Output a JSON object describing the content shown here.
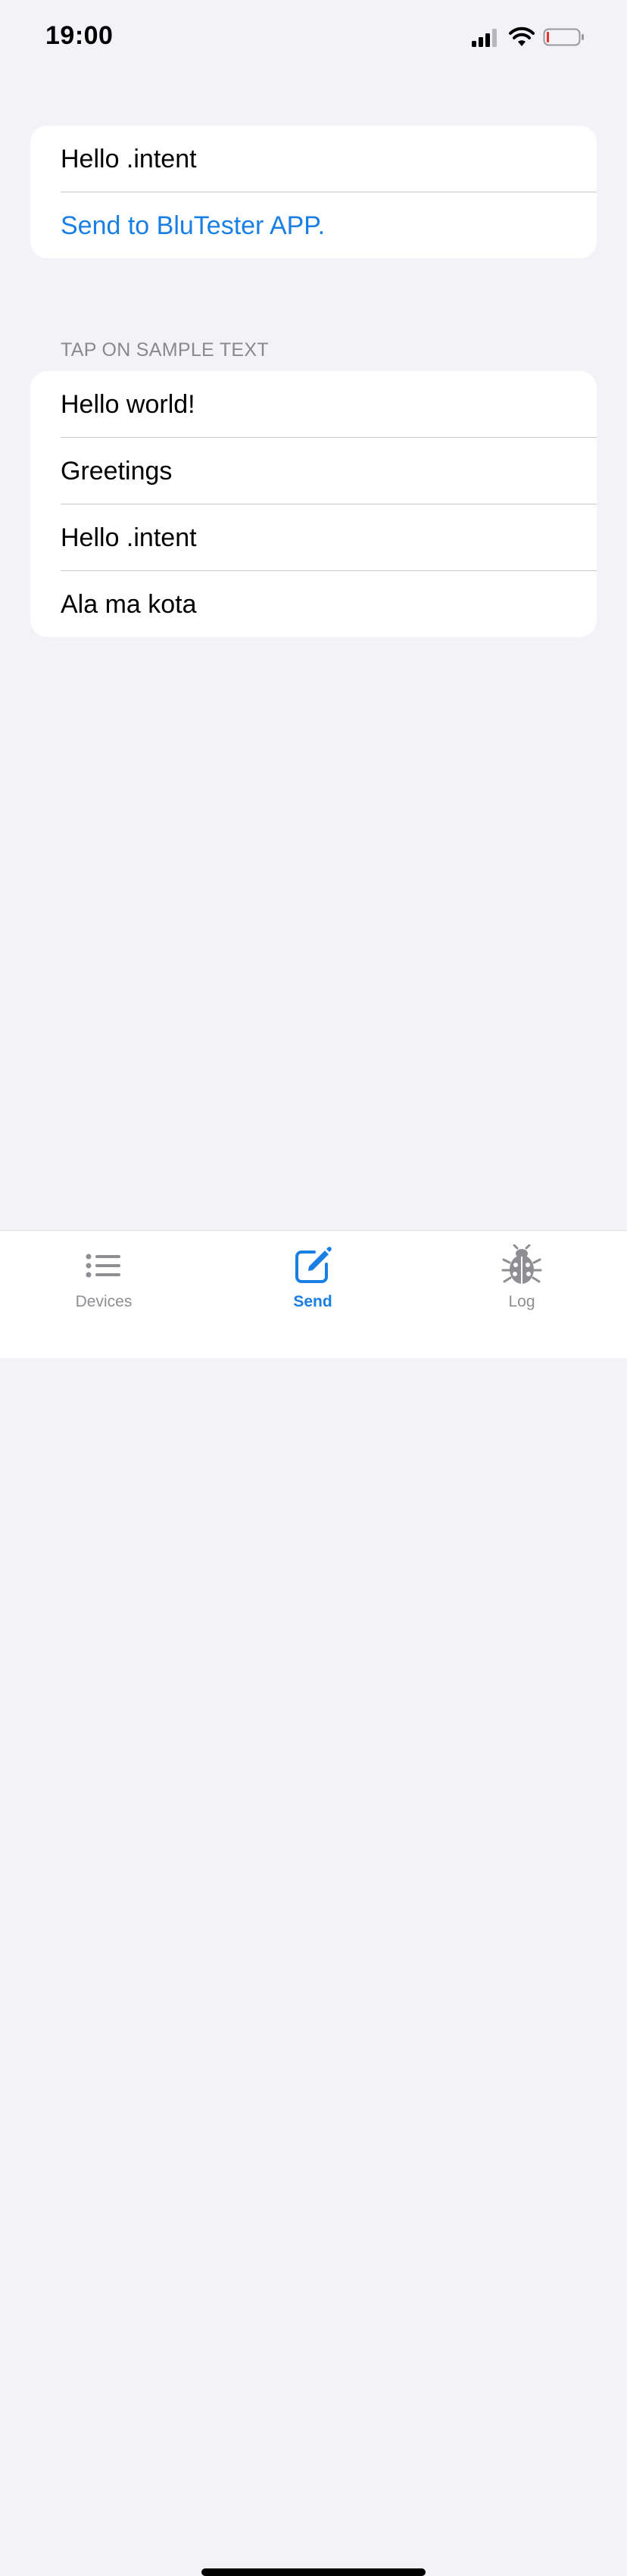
{
  "status_bar": {
    "time": "19:00"
  },
  "top_group": {
    "message": "Hello .intent",
    "send_label": "Send to BluTester APP."
  },
  "samples": {
    "header": "TAP ON SAMPLE TEXT",
    "items": [
      {
        "label": "Hello world!"
      },
      {
        "label": "Greetings"
      },
      {
        "label": "Hello .intent"
      },
      {
        "label": "Ala ma kota"
      }
    ]
  },
  "tab_bar": {
    "tabs": [
      {
        "label": "Devices",
        "icon": "list-icon",
        "active": false
      },
      {
        "label": "Send",
        "icon": "compose-icon",
        "active": true
      },
      {
        "label": "Log",
        "icon": "ladybug-icon",
        "active": false
      }
    ]
  },
  "colors": {
    "accent": "#1a7fe5",
    "background": "#f2f2f7",
    "inactive_tab": "#8e8e93",
    "battery_low": "#e5332a"
  }
}
